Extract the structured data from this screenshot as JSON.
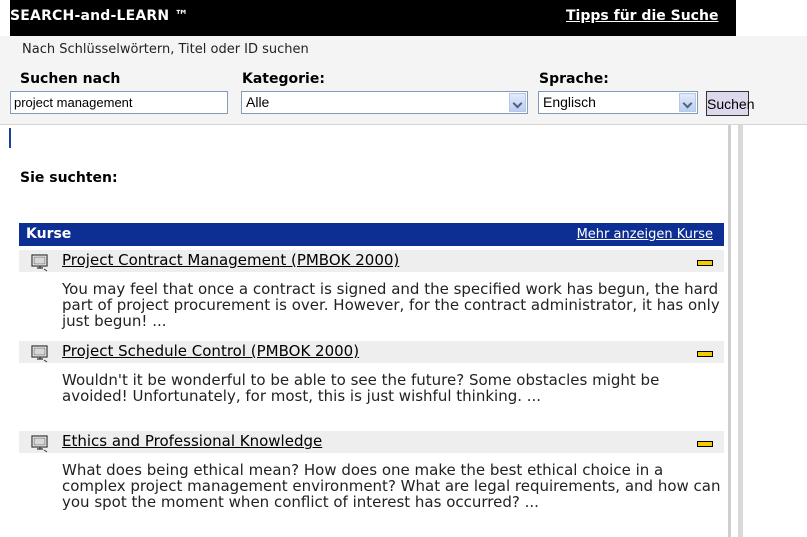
{
  "header": {
    "brand": "SEARCH-and-LEARN ™",
    "tips_link": "Tipps für die Suche"
  },
  "search": {
    "hint": "Nach Schlüsselwörtern, Titel oder ID suchen",
    "query_label": "Suchen nach",
    "query_value": "project management",
    "category_label": "Kategorie:",
    "category_value": "Alle",
    "language_label": "Sprache:",
    "language_value": "Englisch",
    "submit_label": "Suchen"
  },
  "results": {
    "you_searched_label": "Sie suchten:",
    "section_title": "Kurse",
    "more_link": "Mehr anzeigen Kurse",
    "items": [
      {
        "title": "Project Contract Management (PMBOK 2000)",
        "description": "You may feel that once a contract is signed and the specified work has begun, the hard part of project procurement is over. However, for the contract administrator, it has only just begun! ..."
      },
      {
        "title": "Project Schedule Control (PMBOK 2000)",
        "description": "Wouldn't it be wonderful to be able to see the future? Some obstacles might be avoided! Unfortunately, for most, this is just wishful thinking. ..."
      },
      {
        "title": "Ethics and Professional Knowledge",
        "description": "What does being ethical mean? How does one make the best ethical choice in a complex project management environment? What are legal requirements, and how can you spot the moment when conflict of interest has occurred? ..."
      }
    ]
  },
  "icons": {
    "course": "course-monitor-icon",
    "level": "level-indicator-icon",
    "dropdown": "chevron-down-icon"
  },
  "colors": {
    "header_bg": "#000000",
    "section_bg": "#0d2f94",
    "level_badge": "#f0cc00",
    "button_bg": "#ddd8ec"
  }
}
